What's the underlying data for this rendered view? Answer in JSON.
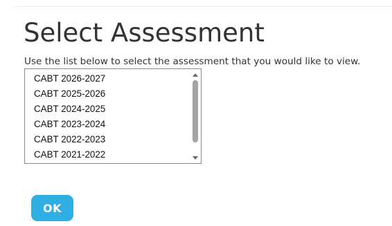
{
  "header": {
    "title": "Select Assessment"
  },
  "instruction": "Use the list below to select the assessment that you would like to view.",
  "assessment_list": {
    "items": [
      {
        "label": "CABT 2026-2027"
      },
      {
        "label": "CABT 2025-2026"
      },
      {
        "label": "CABT 2024-2025"
      },
      {
        "label": "CABT 2023-2024"
      },
      {
        "label": "CABT 2022-2023"
      },
      {
        "label": "CABT 2021-2022"
      }
    ]
  },
  "actions": {
    "ok_label": "OK"
  },
  "colors": {
    "ok_button": "#2eaee3",
    "title_text": "#333333"
  },
  "icons": {
    "scroll_up": "scroll-up-arrow-icon",
    "scroll_down": "scroll-down-arrow-icon"
  }
}
